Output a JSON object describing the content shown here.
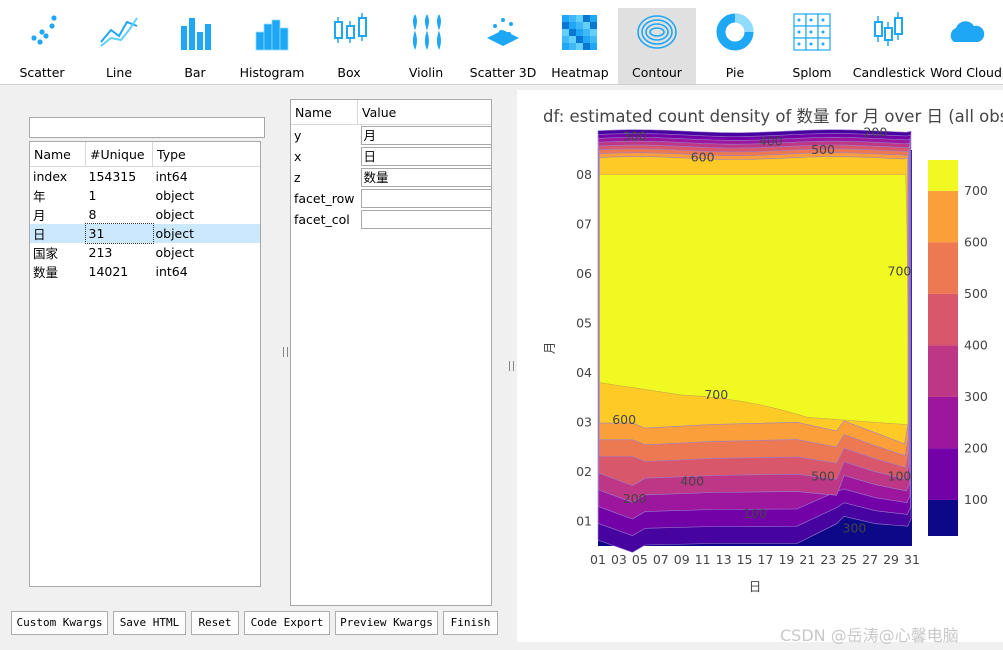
{
  "toolbar": {
    "items": [
      {
        "label": "Scatter",
        "icon": "scatter-icon"
      },
      {
        "label": "Line",
        "icon": "line-icon"
      },
      {
        "label": "Bar",
        "icon": "bar-icon"
      },
      {
        "label": "Histogram",
        "icon": "histogram-icon"
      },
      {
        "label": "Box",
        "icon": "box-icon"
      },
      {
        "label": "Violin",
        "icon": "violin-icon"
      },
      {
        "label": "Scatter 3D",
        "icon": "scatter3d-icon"
      },
      {
        "label": "Heatmap",
        "icon": "heatmap-icon"
      },
      {
        "label": "Contour",
        "icon": "contour-icon",
        "active": true
      },
      {
        "label": "Pie",
        "icon": "pie-icon"
      },
      {
        "label": "Splom",
        "icon": "splom-icon"
      },
      {
        "label": "Candlestick",
        "icon": "candlestick-icon"
      },
      {
        "label": "Word Cloud",
        "icon": "wordcloud-icon"
      }
    ],
    "accent": "#1ea7f5"
  },
  "columns_table": {
    "search_value": "",
    "headers": [
      "Name",
      "#Unique",
      "Type"
    ],
    "rows": [
      [
        "index",
        "154315",
        "int64"
      ],
      [
        "年",
        "1",
        "object"
      ],
      [
        "月",
        "8",
        "object"
      ],
      [
        "日",
        "31",
        "object"
      ],
      [
        "国家",
        "213",
        "object"
      ],
      [
        "数量",
        "14021",
        "int64"
      ]
    ],
    "selected_row": 3
  },
  "kwargs_table": {
    "headers": [
      "Name",
      "Value"
    ],
    "rows": [
      {
        "name": "y",
        "value": "月"
      },
      {
        "name": "x",
        "value": "日"
      },
      {
        "name": "z",
        "value": "数量"
      },
      {
        "name": "facet_row",
        "value": ""
      },
      {
        "name": "facet_col",
        "value": ""
      }
    ]
  },
  "buttons": {
    "custom_kwargs": "Custom Kwargs",
    "save_html": "Save HTML",
    "reset": "Reset",
    "code_export": "Code Export",
    "preview_kwargs": "Preview Kwargs",
    "finish": "Finish"
  },
  "chart_data": {
    "type": "heatmap",
    "title": "df: estimated count density of 数量 for 月  over 日 (all obse",
    "xlabel": "日",
    "ylabel": "月",
    "x_ticks": [
      "01",
      "03",
      "05",
      "07",
      "09",
      "11",
      "13",
      "15",
      "17",
      "19",
      "21",
      "23",
      "25",
      "27",
      "29",
      "31"
    ],
    "y_ticks": [
      "01",
      "02",
      "03",
      "04",
      "05",
      "06",
      "07",
      "08"
    ],
    "colorbar_ticks": [
      100,
      200,
      300,
      400,
      500,
      600,
      700
    ],
    "colorscale": [
      "#0d0887",
      "#46039f",
      "#7201a8",
      "#9c179e",
      "#bd3786",
      "#d8576b",
      "#ed7953",
      "#fb9f3a",
      "#fdca26",
      "#f0f921"
    ],
    "contour_labels": [
      {
        "text": "300",
        "x": 4.5,
        "y": 8.77
      },
      {
        "text": "400",
        "x": 17.5,
        "y": 8.67
      },
      {
        "text": "200",
        "x": 27.5,
        "y": 8.85
      },
      {
        "text": "600",
        "x": 11.0,
        "y": 8.35
      },
      {
        "text": "500",
        "x": 22.5,
        "y": 8.5
      },
      {
        "text": "700",
        "x": 29.8,
        "y": 6.05
      },
      {
        "text": "700",
        "x": 12.3,
        "y": 3.55
      },
      {
        "text": "600",
        "x": 3.5,
        "y": 3.05
      },
      {
        "text": "500",
        "x": 22.5,
        "y": 1.9
      },
      {
        "text": "400",
        "x": 10.0,
        "y": 1.8
      },
      {
        "text": "200",
        "x": 4.5,
        "y": 1.45
      },
      {
        "text": "100",
        "x": 16.0,
        "y": 1.15
      },
      {
        "text": "100",
        "x": 29.8,
        "y": 1.9
      },
      {
        "text": "300",
        "x": 25.5,
        "y": 0.85
      }
    ]
  },
  "watermark": "CSDN @岳涛@心馨电脑"
}
